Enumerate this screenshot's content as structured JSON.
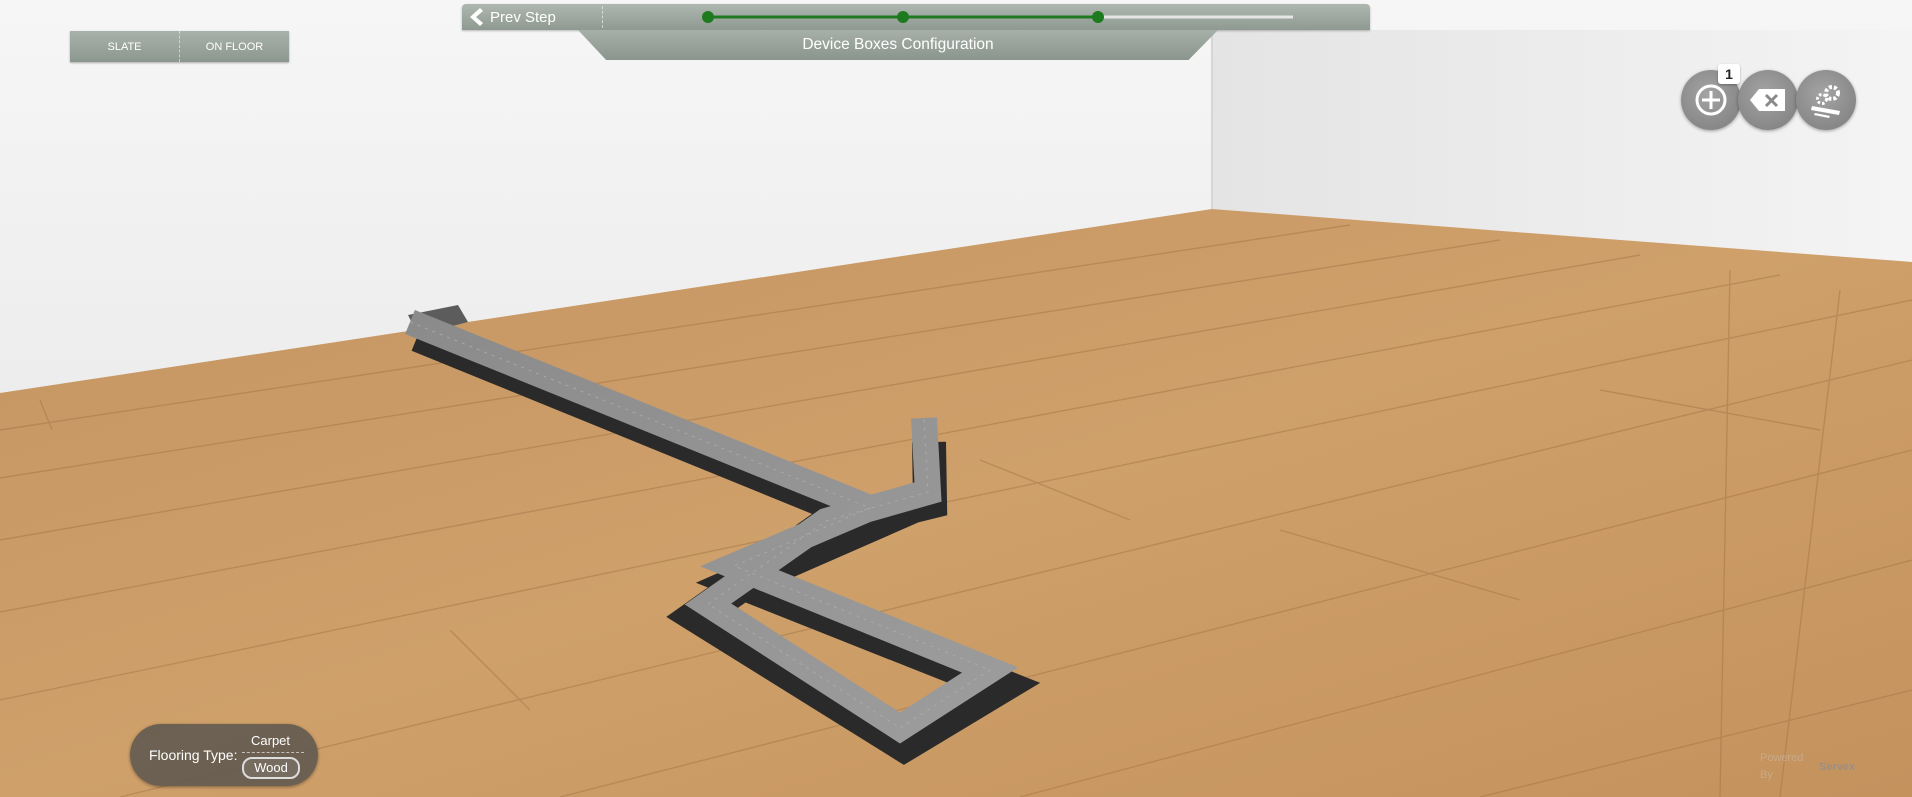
{
  "toolbar": {
    "prev_step_label": "Prev Step",
    "progress": {
      "total_steps": 4,
      "completed_steps": 3
    }
  },
  "title": "Device Boxes Configuration",
  "install_type": {
    "options": [
      "SLATE",
      "ON FLOOR"
    ]
  },
  "tools": {
    "add_badge": "1"
  },
  "flooring": {
    "label": "Flooring Type:",
    "options": [
      "Carpet",
      "Wood"
    ],
    "selected": "Wood"
  },
  "powered_by": {
    "line1": "Powered",
    "line2": "By",
    "brand": "Servex"
  },
  "colors": {
    "toolbar": "#9aa49c",
    "progress_active": "#1e7a1e",
    "progress_inactive": "#e6e6e6",
    "wall": "#ececec",
    "floor": "#c99a62",
    "raceway": "#6e6e6e"
  }
}
